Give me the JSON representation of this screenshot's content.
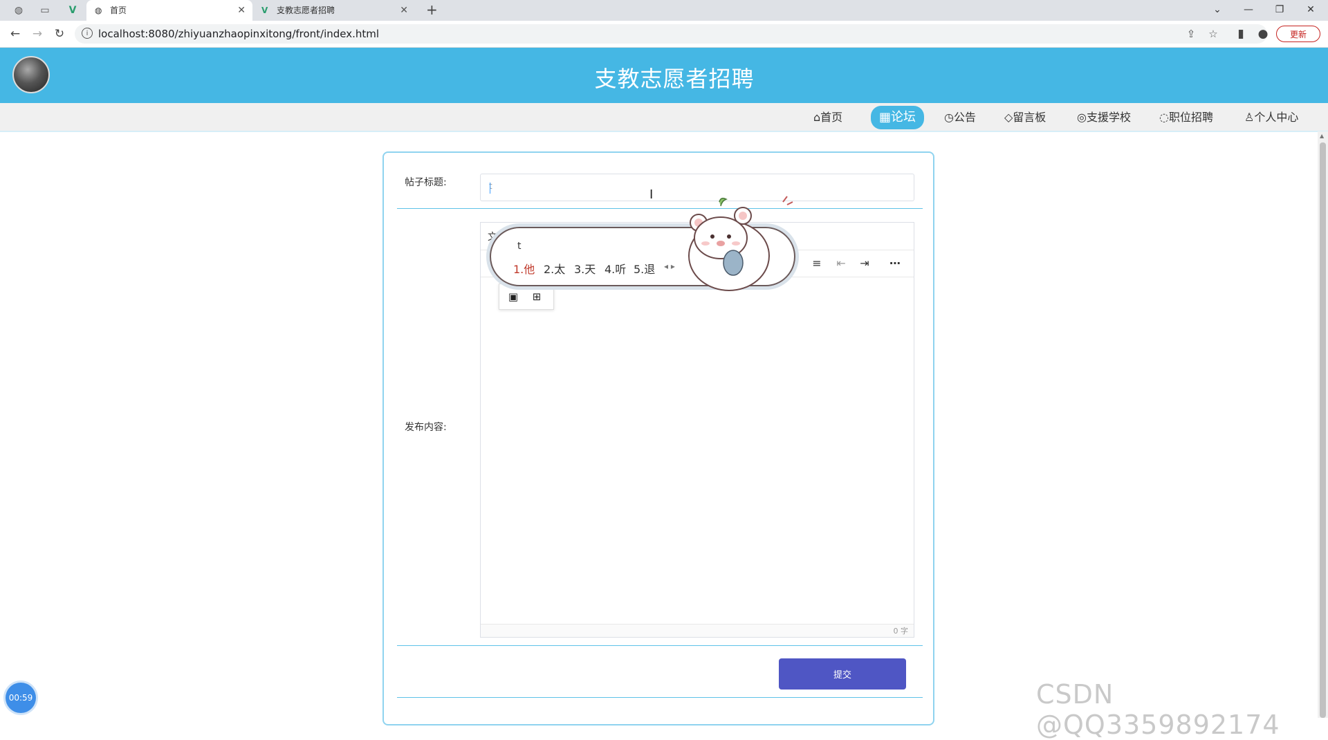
{
  "browser": {
    "tabs": [
      {
        "label": "首页",
        "active": true
      },
      {
        "label": "支教志愿者招聘",
        "active": false
      }
    ],
    "url": "localhost:8080/zhiyuanzhaopinxitong/front/index.html",
    "update_label": "更新"
  },
  "site": {
    "title": "支教志愿者招聘",
    "nav": [
      {
        "icon": "home-icon",
        "label": "⌂首页",
        "active": false
      },
      {
        "icon": "forum-icon",
        "label": "▦论坛",
        "active": true
      },
      {
        "icon": "notice-icon",
        "label": "◷公告",
        "active": false
      },
      {
        "icon": "message-icon",
        "label": "◇留言板",
        "active": false
      },
      {
        "icon": "school-icon",
        "label": "◎支援学校",
        "active": false
      },
      {
        "icon": "job-icon",
        "label": "◌职位招聘",
        "active": false
      },
      {
        "icon": "user-icon",
        "label": "♙个人中心",
        "active": false
      }
    ]
  },
  "form": {
    "title_label": "帖子标题:",
    "title_value": "t",
    "content_label": "发布内容:",
    "editor_toolbar_label": "文件",
    "word_count": "0 字",
    "submit_label": "提交"
  },
  "ime": {
    "composition": "t",
    "candidates": [
      "1.他",
      "2.太",
      "3.天",
      "4.听",
      "5.退"
    ]
  },
  "overlay": {
    "timer": "00:59",
    "watermark": "CSDN @QQ3359892174"
  },
  "colors": {
    "header": "#45b7e4",
    "submit": "#4f56c4",
    "card_border": "#8fd3ef"
  }
}
